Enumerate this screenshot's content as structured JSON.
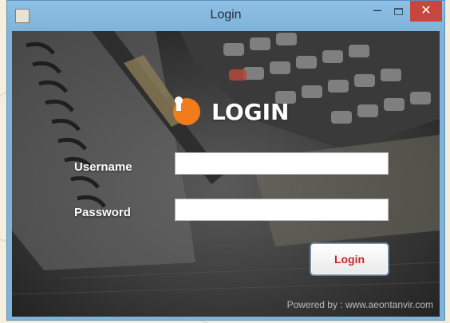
{
  "window": {
    "title": "Login",
    "minimize_glyph": "–",
    "close_glyph": "✕"
  },
  "login": {
    "heading": "LOGIN",
    "icon": "keyhole-icon",
    "accent_color": "#f07c1c"
  },
  "form": {
    "username_label": "Username",
    "username_value": "",
    "password_label": "Password",
    "password_value": "",
    "submit_label": "Login",
    "submit_color": "#c3272f"
  },
  "footer": {
    "powered_by": "Powered by : www.aeontanvir.com"
  }
}
